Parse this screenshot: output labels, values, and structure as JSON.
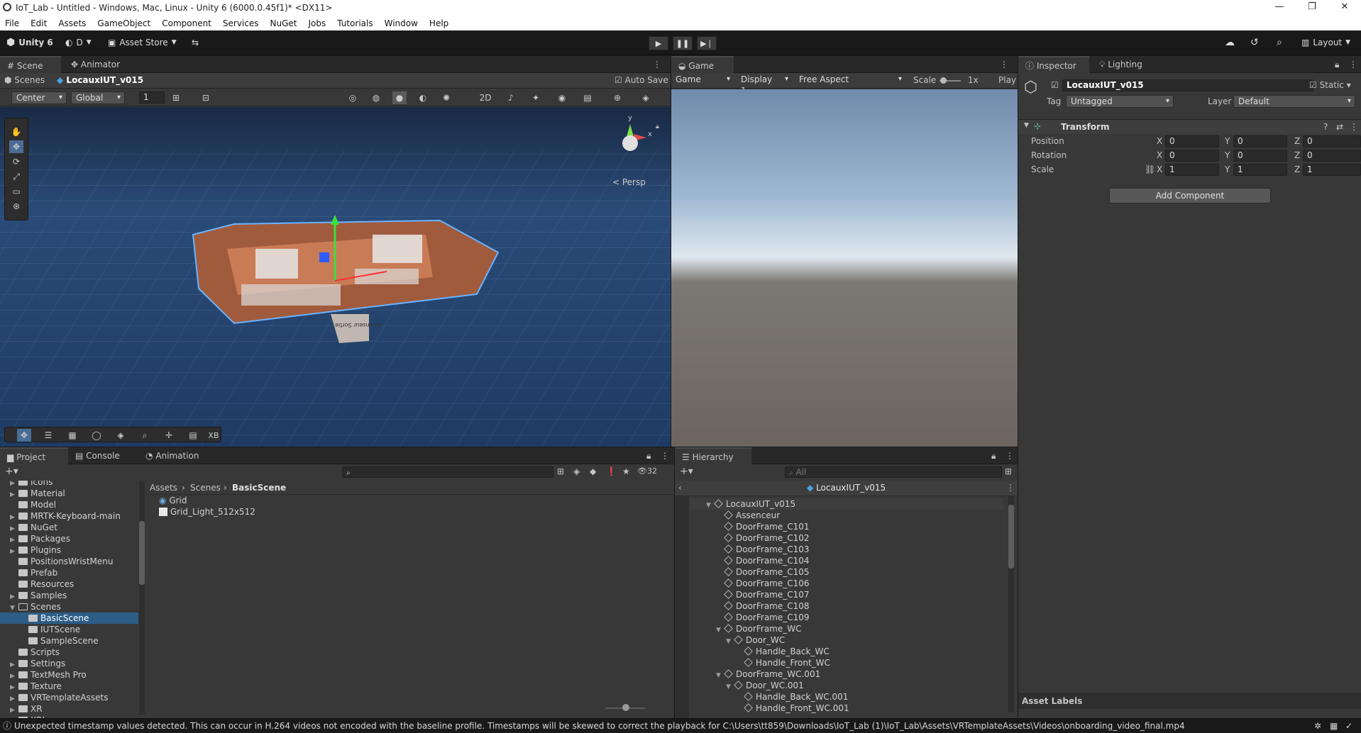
{
  "window": {
    "title": "IoT_Lab - Untitled - Windows, Mac, Linux - Unity 6 (6000.0.45f1)* <DX11>",
    "minimize": "—",
    "maximize": "❐",
    "close": "✕"
  },
  "menu": [
    "File",
    "Edit",
    "Assets",
    "GameObject",
    "Component",
    "Services",
    "NuGet",
    "Jobs",
    "Tutorials",
    "Window",
    "Help"
  ],
  "toolbar": {
    "unity": "Unity 6",
    "account": "D",
    "asset_store": "Asset Store",
    "layout": "Layout"
  },
  "scene_panel": {
    "tabs": [
      "Scene",
      "Animator"
    ],
    "breadcrumb_root": "Scenes",
    "breadcrumb_obj": "LocauxIUT_v015",
    "auto_save": "Auto Save",
    "pivot": "Center",
    "space": "Global",
    "snap_value": "1",
    "persp": "< Persp",
    "gizmo_y": "y",
    "gizmo_x": "x",
    "bottom_xb": "XB",
    "sign_text": "ascenseur Sortie"
  },
  "game_panel": {
    "tab": "Game",
    "mode": "Game",
    "display": "Display 1",
    "aspect": "Free Aspect",
    "scale_label": "Scale",
    "scale_value": "1x",
    "play": "Play"
  },
  "inspector": {
    "tabs": [
      "Inspector",
      "Lighting"
    ],
    "object_name": "LocauxIUT_v015",
    "static": "Static",
    "tag_label": "Tag",
    "tag": "Untagged",
    "layer_label": "Layer",
    "layer": "Default",
    "component": "Transform",
    "rows": [
      {
        "label": "Position",
        "x": "0",
        "y": "0",
        "z": "0"
      },
      {
        "label": "Rotation",
        "x": "0",
        "y": "0",
        "z": "0"
      },
      {
        "label": "Scale",
        "x": "1",
        "y": "1",
        "z": "1"
      }
    ],
    "add_component": "Add Component",
    "asset_labels": "Asset Labels"
  },
  "project": {
    "tabs": [
      "Project",
      "Console",
      "Animation"
    ],
    "count": "32",
    "breadcrumb": [
      "Assets",
      "Scenes",
      "BasicScene"
    ],
    "tree": [
      {
        "label": "Icons",
        "indent": 1,
        "arrow": "▶"
      },
      {
        "label": "Material",
        "indent": 1,
        "arrow": "▶"
      },
      {
        "label": "Model",
        "indent": 1,
        "arrow": ""
      },
      {
        "label": "MRTK-Keyboard-main",
        "indent": 1,
        "arrow": "▶"
      },
      {
        "label": "NuGet",
        "indent": 1,
        "arrow": "▶"
      },
      {
        "label": "Packages",
        "indent": 1,
        "arrow": "▶"
      },
      {
        "label": "Plugins",
        "indent": 1,
        "arrow": "▶"
      },
      {
        "label": "PositionsWristMenu",
        "indent": 1,
        "arrow": ""
      },
      {
        "label": "Prefab",
        "indent": 1,
        "arrow": ""
      },
      {
        "label": "Resources",
        "indent": 1,
        "arrow": ""
      },
      {
        "label": "Samples",
        "indent": 1,
        "arrow": "▶"
      },
      {
        "label": "Scenes",
        "indent": 1,
        "arrow": "▼"
      },
      {
        "label": "BasicScene",
        "indent": 2,
        "arrow": "",
        "selected": true
      },
      {
        "label": "IUTScene",
        "indent": 2,
        "arrow": ""
      },
      {
        "label": "SampleScene",
        "indent": 2,
        "arrow": ""
      },
      {
        "label": "Scripts",
        "indent": 1,
        "arrow": ""
      },
      {
        "label": "Settings",
        "indent": 1,
        "arrow": "▶"
      },
      {
        "label": "TextMesh Pro",
        "indent": 1,
        "arrow": "▶"
      },
      {
        "label": "Texture",
        "indent": 1,
        "arrow": "▶"
      },
      {
        "label": "VRTemplateAssets",
        "indent": 1,
        "arrow": "▶"
      },
      {
        "label": "XR",
        "indent": 1,
        "arrow": "▶"
      },
      {
        "label": "XRI",
        "indent": 1,
        "arrow": "▶"
      }
    ],
    "files": [
      "Grid",
      "Grid_Light_512x512"
    ]
  },
  "hierarchy": {
    "tab": "Hierarchy",
    "search_placeholder": "All",
    "scene": "LocauxIUT_v015",
    "items": [
      {
        "label": "LocauxIUT_v015",
        "indent": 0,
        "arrow": "▼"
      },
      {
        "label": "Assenceur",
        "indent": 1,
        "arrow": ""
      },
      {
        "label": "DoorFrame_C101",
        "indent": 1,
        "arrow": ""
      },
      {
        "label": "DoorFrame_C102",
        "indent": 1,
        "arrow": ""
      },
      {
        "label": "DoorFrame_C103",
        "indent": 1,
        "arrow": ""
      },
      {
        "label": "DoorFrame_C104",
        "indent": 1,
        "arrow": ""
      },
      {
        "label": "DoorFrame_C105",
        "indent": 1,
        "arrow": ""
      },
      {
        "label": "DoorFrame_C106",
        "indent": 1,
        "arrow": ""
      },
      {
        "label": "DoorFrame_C107",
        "indent": 1,
        "arrow": ""
      },
      {
        "label": "DoorFrame_C108",
        "indent": 1,
        "arrow": ""
      },
      {
        "label": "DoorFrame_C109",
        "indent": 1,
        "arrow": ""
      },
      {
        "label": "DoorFrame_WC",
        "indent": 1,
        "arrow": "▼"
      },
      {
        "label": "Door_WC",
        "indent": 2,
        "arrow": "▼"
      },
      {
        "label": "Handle_Back_WC",
        "indent": 3,
        "arrow": ""
      },
      {
        "label": "Handle_Front_WC",
        "indent": 3,
        "arrow": ""
      },
      {
        "label": "DoorFrame_WC.001",
        "indent": 1,
        "arrow": "▼"
      },
      {
        "label": "Door_WC.001",
        "indent": 2,
        "arrow": "▼"
      },
      {
        "label": "Handle_Back_WC.001",
        "indent": 3,
        "arrow": ""
      },
      {
        "label": "Handle_Front_WC.001",
        "indent": 3,
        "arrow": ""
      }
    ]
  },
  "status": {
    "message": "Unexpected timestamp values detected. This can occur in H.264 videos not encoded with the baseline profile. Timestamps will be skewed to correct the playback for C:\\Users\\tt859\\Downloads\\IoT_Lab (1)\\IoT_Lab\\Assets\\VRTemplateAssets\\Videos\\onboarding_video_final.mp4"
  }
}
